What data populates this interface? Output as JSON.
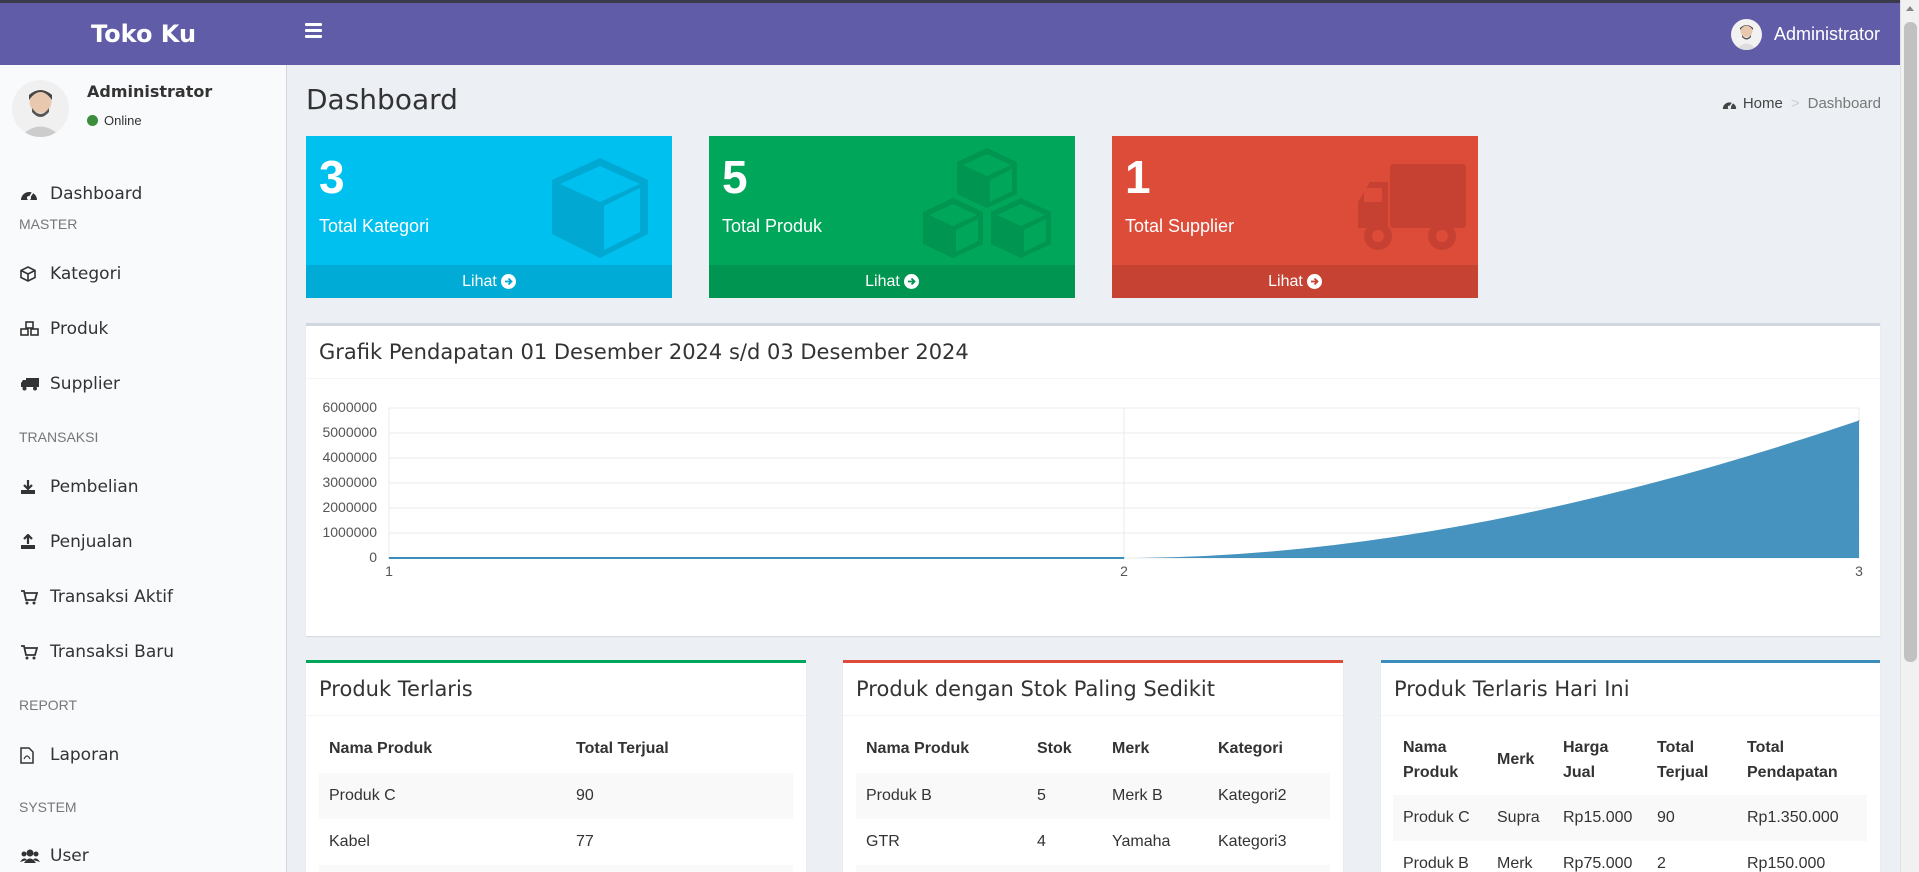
{
  "app": {
    "title": "Toko Ku"
  },
  "navbar": {
    "user_name": "Administrator"
  },
  "sidebar": {
    "user_name": "Administrator",
    "status": "Online",
    "items": [
      {
        "label": "Dashboard",
        "icon": "dashboard-icon"
      },
      {
        "header": "MASTER"
      },
      {
        "label": "Kategori",
        "icon": "cube-icon"
      },
      {
        "label": "Produk",
        "icon": "cubes-icon"
      },
      {
        "label": "Supplier",
        "icon": "truck-icon"
      },
      {
        "header": "TRANSAKSI"
      },
      {
        "label": "Pembelian",
        "icon": "download-icon"
      },
      {
        "label": "Penjualan",
        "icon": "upload-icon"
      },
      {
        "label": "Transaksi Aktif",
        "icon": "cart-icon"
      },
      {
        "label": "Transaksi Baru",
        "icon": "cart-icon"
      },
      {
        "header": "REPORT"
      },
      {
        "label": "Laporan",
        "icon": "file-pdf-icon"
      },
      {
        "header": "SYSTEM"
      },
      {
        "label": "User",
        "icon": "users-icon"
      }
    ]
  },
  "page": {
    "title": "Dashboard",
    "breadcrumb": {
      "home": "Home",
      "current": "Dashboard"
    }
  },
  "stat_boxes": [
    {
      "value": "3",
      "label": "Total Kategori",
      "link": "Lihat",
      "color": "#00c0ef",
      "icon": "cube-icon"
    },
    {
      "value": "5",
      "label": "Total Produk",
      "link": "Lihat",
      "color": "#00a65a",
      "icon": "cubes-icon"
    },
    {
      "value": "1",
      "label": "Total Supplier",
      "link": "Lihat",
      "color": "#dd4b39",
      "icon": "truck-icon"
    }
  ],
  "chart_box": {
    "title": "Grafik Pendapatan 01 Desember 2024 s/d 03 Desember 2024"
  },
  "chart_data": {
    "type": "area",
    "x": [
      1,
      2,
      3
    ],
    "values": [
      0,
      0,
      5500000
    ],
    "title": "Grafik Pendapatan 01 Desember 2024 s/d 03 Desember 2024",
    "xlabel": "",
    "ylabel": "",
    "ylim": [
      0,
      6000000
    ],
    "yticks": [
      "6000000",
      "5000000",
      "4000000",
      "3000000",
      "2000000",
      "1000000",
      "0"
    ],
    "xticks": [
      "1",
      "2",
      "3"
    ],
    "grid": true,
    "color": "#3c8dbc"
  },
  "tables": {
    "terlaris": {
      "title": "Produk Terlaris",
      "accent": "#00a65a",
      "headers": [
        "Nama Produk",
        "Total Terjual"
      ],
      "rows": [
        [
          "Produk C",
          "90"
        ],
        [
          "Kabel",
          "77"
        ]
      ]
    },
    "stok": {
      "title": "Produk dengan Stok Paling Sedikit",
      "accent": "#dd4b39",
      "headers": [
        "Nama Produk",
        "Stok",
        "Merk",
        "Kategori"
      ],
      "rows": [
        [
          "Produk B",
          "5",
          "Merk B",
          "Kategori2"
        ],
        [
          "GTR",
          "4",
          "Yamaha",
          "Kategori3"
        ]
      ]
    },
    "hari_ini": {
      "title": "Produk Terlaris Hari Ini",
      "accent": "#3c8dbc",
      "headers": [
        "Nama Produk",
        "Merk",
        "Harga Jual",
        "Total Terjual",
        "Total Pendapatan"
      ],
      "rows": [
        [
          "Produk C",
          "Supra",
          "Rp15.000",
          "90",
          "Rp1.350.000"
        ],
        [
          "Produk B",
          "Merk",
          "Rp75.000",
          "2",
          "Rp150.000"
        ]
      ]
    }
  }
}
